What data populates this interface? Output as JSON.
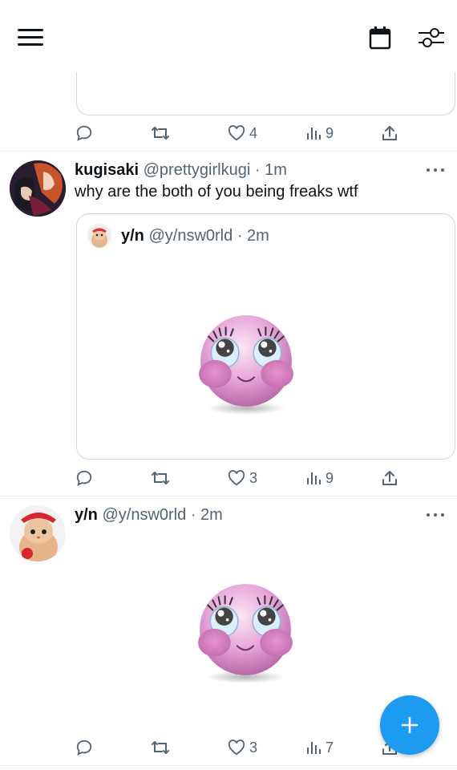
{
  "header": {
    "menu_icon": "hamburger-icon",
    "calendar_icon": "calendar-icon",
    "filter_icon": "sliders-icon"
  },
  "posts": [
    {
      "id": "partial-top",
      "actions": {
        "replies": "",
        "reposts": "",
        "likes": "4",
        "views": "9"
      }
    },
    {
      "id": "kugisaki",
      "display_name": "kugisaki",
      "handle": "@prettygirlkugi",
      "time": "1m",
      "text": "why are the both of you being freaks wtf",
      "quote": {
        "display_name": "y/n",
        "handle": "@y/nsw0rld",
        "time": "2m"
      },
      "actions": {
        "replies": "",
        "reposts": "",
        "likes": "3",
        "views": "9"
      }
    },
    {
      "id": "yn",
      "display_name": "y/n",
      "handle": "@y/nsw0rld",
      "time": "2m",
      "actions": {
        "replies": "",
        "reposts": "",
        "likes": "3",
        "views": "7"
      }
    }
  ],
  "separator": "·",
  "fab": {
    "icon": "plus-icon",
    "color": "#1d9bf0"
  },
  "colors": {
    "text": "#0f1419",
    "muted": "#536471",
    "border": "#cfd9de",
    "accent": "#1d9bf0"
  }
}
